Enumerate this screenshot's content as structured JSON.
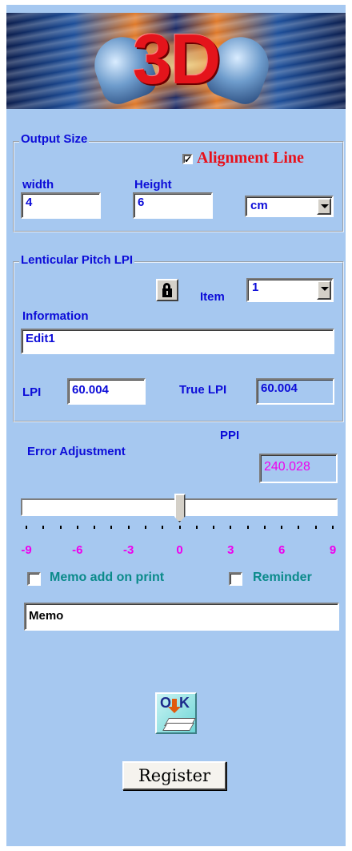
{
  "banner": {
    "logo_text": "3D"
  },
  "output_size": {
    "title": "Output Size",
    "alignment_line": {
      "label": "Alignment Line",
      "checked": true
    },
    "width_label": "width",
    "width_value": "4",
    "height_label": "Height",
    "height_value": "6",
    "unit_selected": "cm"
  },
  "lenticular": {
    "title": "Lenticular Pitch LPI",
    "item_label": "Item",
    "item_selected": "1",
    "information_label": "Information",
    "information_value": "Edit1",
    "lpi_label": "LPI",
    "lpi_value": "60.004",
    "true_lpi_label": "True LPI",
    "true_lpi_value": "60.004"
  },
  "error_adjustment": {
    "label": "Error Adjustment",
    "ppi_label": "PPI",
    "ppi_value": "240.028",
    "slider_value": 0,
    "slider_min": -9,
    "slider_max": 9,
    "scale_labels": [
      "-9",
      "-6",
      "-3",
      "0",
      "3",
      "6",
      "9"
    ]
  },
  "memo": {
    "memo_add_on_print_label": "Memo add on print",
    "memo_add_on_print_checked": false,
    "reminder_label": "Reminder",
    "reminder_checked": false,
    "memo_value": "Memo"
  },
  "buttons": {
    "ok_letters": [
      "O",
      "K"
    ],
    "register_label": "Register"
  },
  "colors": {
    "panel_bg": "#a6c8f0",
    "label_blue": "#0c0cd8",
    "alignment_red": "#e8101a",
    "ppi_magenta": "#ee00ee",
    "memo_teal": "#0a8a8a"
  }
}
